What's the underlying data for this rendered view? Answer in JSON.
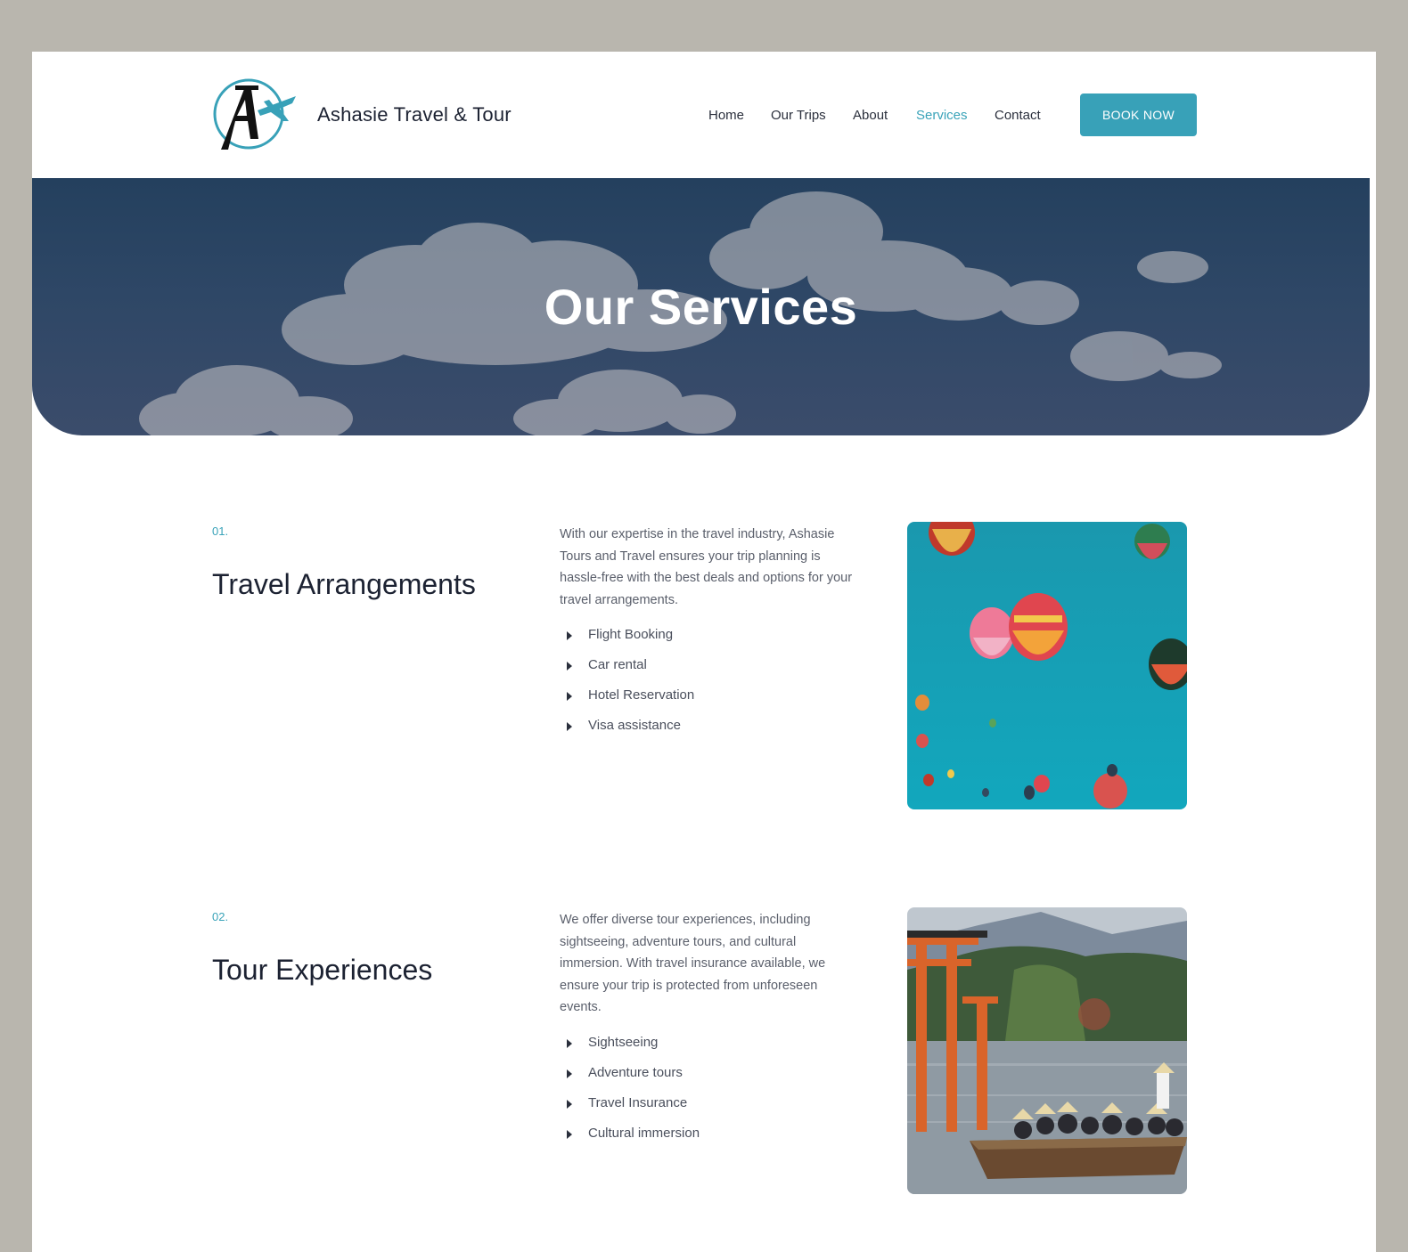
{
  "header": {
    "brand": "Ashasie Travel & Tour",
    "nav": [
      {
        "label": "Home",
        "active": false
      },
      {
        "label": "Our Trips",
        "active": false
      },
      {
        "label": "About",
        "active": false
      },
      {
        "label": "Services",
        "active": true
      },
      {
        "label": "Contact",
        "active": false
      }
    ],
    "cta": "BOOK NOW",
    "logo_letter": "A"
  },
  "hero": {
    "title": "Our Services"
  },
  "services": [
    {
      "number": "01.",
      "title": "Travel Arrangements",
      "description": "With our expertise in the travel industry, Ashasie Tours and Travel ensures your trip planning is hassle-free with the best deals and options for your travel arrangements.",
      "items": [
        "Flight Booking",
        "Car rental",
        "Hotel Reservation",
        "Visa assistance"
      ],
      "image": "hot-air-balloons-image"
    },
    {
      "number": "02.",
      "title": "Tour Experiences",
      "description": "We offer diverse tour experiences, including sightseeing, adventure tours, and cultural immersion. With travel insurance available, we ensure your trip is protected from unforeseen events.",
      "items": [
        "Sightseeing",
        "Adventure tours",
        "Travel Insurance",
        "Cultural immersion"
      ],
      "image": "boat-torii-gate-image"
    }
  ],
  "colors": {
    "accent": "#38a1b8",
    "text_dark": "#1c2232",
    "text_muted": "#5a5f6b",
    "hero_bg": "#2e4766"
  }
}
